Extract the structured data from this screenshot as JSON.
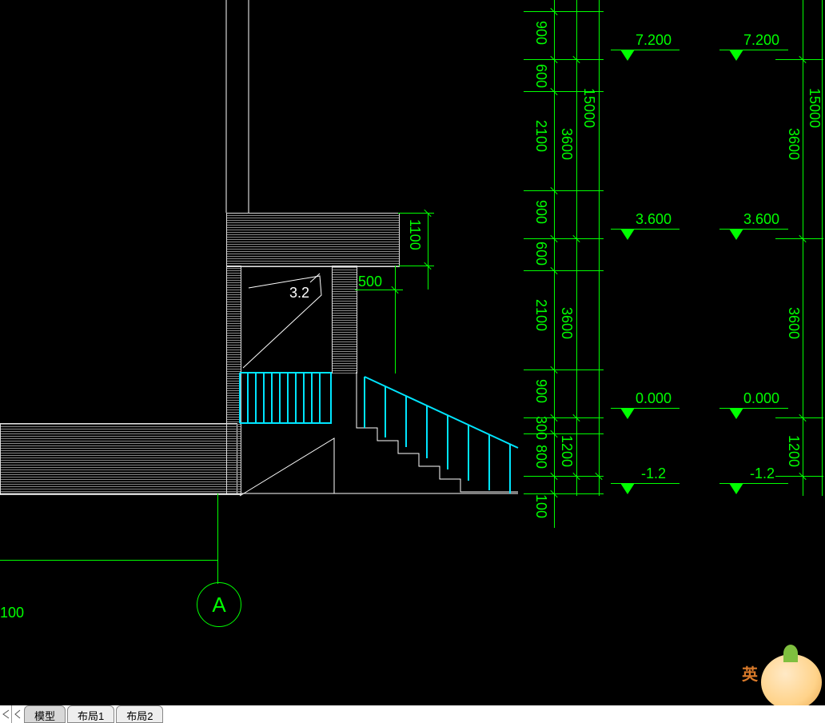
{
  "domain": "Diagram",
  "drawing_type": "CAD-section/elevation",
  "tabs": {
    "model": "模型",
    "layout1": "布局1",
    "layout2": "布局2"
  },
  "ime": {
    "mode": "英"
  },
  "grid": {
    "bubble_A": "A"
  },
  "labels": {
    "left_bottom_dim": "100",
    "in_beam": "3.2",
    "dim_1100": "1100",
    "dim_500": "500"
  },
  "dim_stack_1": {
    "segments": [
      "900",
      "600",
      "2100",
      "900",
      "600",
      "2100",
      "900",
      "300",
      "800",
      "100"
    ],
    "overall_mid": [
      "3600",
      "3600",
      "1200"
    ],
    "overall_big": "15000"
  },
  "levels_1": {
    "top": "7.200",
    "mid": "3.600",
    "zero": "0.000",
    "base": "-1.2"
  },
  "dim_stack_2": {
    "overall_big": "15000",
    "overall_mid": [
      "3600",
      "3600",
      "1200"
    ]
  },
  "levels_2": {
    "top": "7.200",
    "mid": "3.600",
    "zero": "0.000",
    "base": "-1.2"
  }
}
